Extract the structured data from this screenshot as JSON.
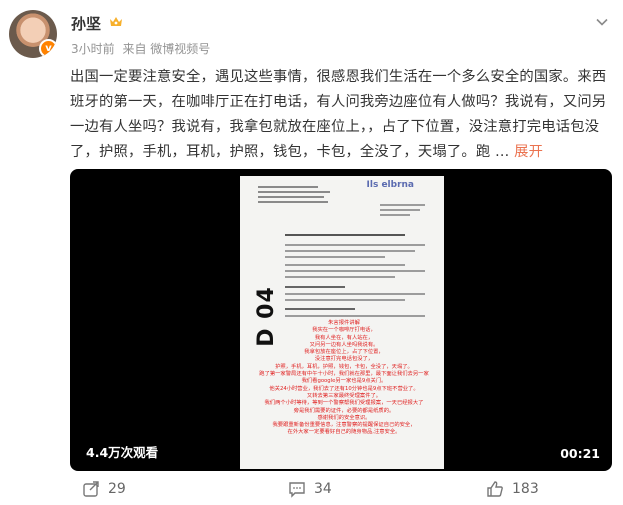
{
  "post": {
    "author": "孙坚",
    "time": "3小时前",
    "source": "来自 微博视频号",
    "content": "出国一定要注意安全，遇见这些事情，很感恩我们生活在一个多么安全的国家。来西班牙的第一天，在咖啡厅正在打电话，有人问我旁边座位有人做吗？我说有，又问另一边有人坐吗？我说有，我拿包就放在座位上，，占了下位置，没注意打完电话包没了，护照，手机，耳机，护照，钱包，卡包，全没了，天塌了。跑 ...",
    "expand_label": "展开",
    "verified_icon": "v-badge-icon"
  },
  "video": {
    "views": "4.4万次观看",
    "duration": "00:21",
    "doc_logo": "Ils elbrna",
    "doc_big_label": "D 04",
    "doc_red_lines": [
      "朱言报件讲解",
      "我实在一个咖啡厅打电话，",
      "我有人坐在，有人站在，",
      "又问另一边有人坐吗我说有。",
      "我拿包放在座位上，占了下位置，",
      "没注意打完电话包没了，",
      "护照，手机，耳机，护照，钱包，卡包，全没了，天塌了。",
      "跑了第一家警局还有中午十小时，我们就在那里，最下面让我们去另一家",
      "我们看google另一家也是9点关门。",
      "他关24小时营业，我们去了还有10分钟也是9点下班不营业了。",
      "又转去第三家最终受理案件了。",
      "我们两个小时等待，等到一个警察帮我们受理报案，一天已经报大了",
      "旁是我们需要的证件，必要的都是纸质的。",
      "感谢我们的安全意识。",
      "我要跟重新备份重要信息，注意警察的提醒保证自己的安全，",
      "在外大家一定要看好自己的随身物品,注意安全。"
    ]
  },
  "actions": {
    "repost_count": "29",
    "comment_count": "34",
    "like_count": "183"
  }
}
